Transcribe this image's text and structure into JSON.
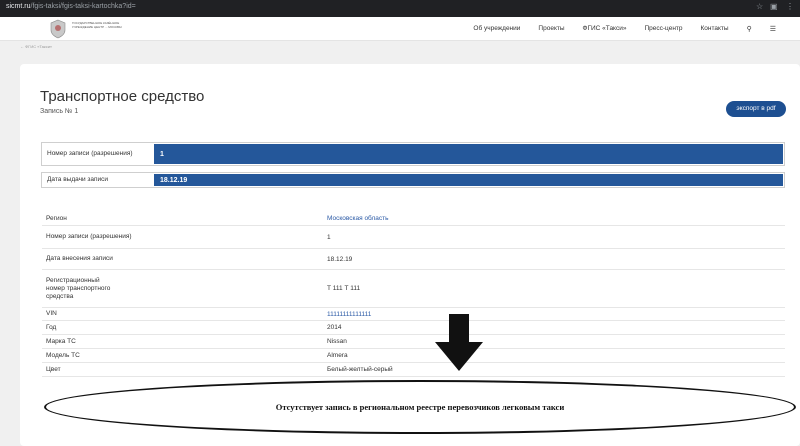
{
  "browser": {
    "url_domain": "sicmt.ru",
    "url_path": "/fgis-taksi/fgis-taksi-kartochka?id=",
    "controls": [
      "☆",
      "▣",
      "⋮"
    ]
  },
  "header": {
    "logo_text": "ГОСУДАРСТВЕННОЕ КАЗЁННОЕ УЧРЕЖДЕНИЕ ЦЕНТР ... МОСКВЫ",
    "nav": [
      "Об учреждении",
      "Проекты",
      "ФГИС «Такси»",
      "Пресс-центр",
      "Контакты"
    ],
    "icons": [
      "search-icon",
      "menu-icon"
    ]
  },
  "breadcrumb": "← ФГИС «Такси»",
  "page": {
    "title": "Транспортное средство",
    "record_no": "Запись № 1",
    "export_label": "экспорт в pdf",
    "highlight_rows": [
      {
        "label": "Номер записи (разрешения)",
        "value": "1"
      },
      {
        "label": "Дата выдачи записи",
        "value": "18.12.19"
      }
    ],
    "details": [
      {
        "label": "Регион",
        "value": "Московская область",
        "link": true
      },
      {
        "label": "Номер записи (разрешения)",
        "value": "1",
        "link": false
      },
      {
        "label": "Дата внесения записи",
        "value": "18.12.19",
        "link": false
      },
      {
        "label": "Регистрационный номер транспортного средства",
        "value": "Т 111 Т 111",
        "link": false
      },
      {
        "label": "VIN",
        "value": "11111111111111",
        "link": true
      },
      {
        "label": "Год",
        "value": "2014",
        "link": false
      },
      {
        "label": "Марка ТС",
        "value": "Nissan",
        "link": false
      },
      {
        "label": "Модель ТС",
        "value": "Almera",
        "link": false
      },
      {
        "label": "Цвет",
        "value": "Белый-желтый-серый",
        "link": false
      }
    ]
  },
  "annotation": {
    "text": "Отсутствует запись в региональном реестре перевозчиков легковым такси"
  },
  "colors": {
    "accent": "#24579a",
    "button": "#1d4f91",
    "chrome": "#202124"
  }
}
